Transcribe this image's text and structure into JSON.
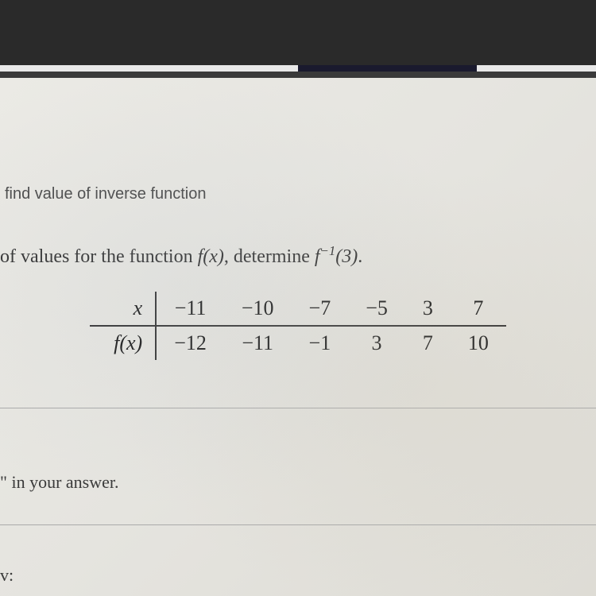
{
  "heading": "find value of inverse function",
  "question": {
    "prefix": "of values for the function ",
    "func1": "f(x)",
    "middle": ", determine ",
    "func2_base": "f",
    "func2_sup": "−1",
    "func2_arg": "(3)",
    "suffix": "."
  },
  "table": {
    "row1_label": "x",
    "row2_label": "f(x)",
    "x_values": [
      "−11",
      "−10",
      "−7",
      "−5",
      "3",
      "7"
    ],
    "fx_values": [
      "−12",
      "−11",
      "−1",
      "3",
      "7",
      "10"
    ]
  },
  "hint": "\" in your answer.",
  "answer_label": "v:"
}
